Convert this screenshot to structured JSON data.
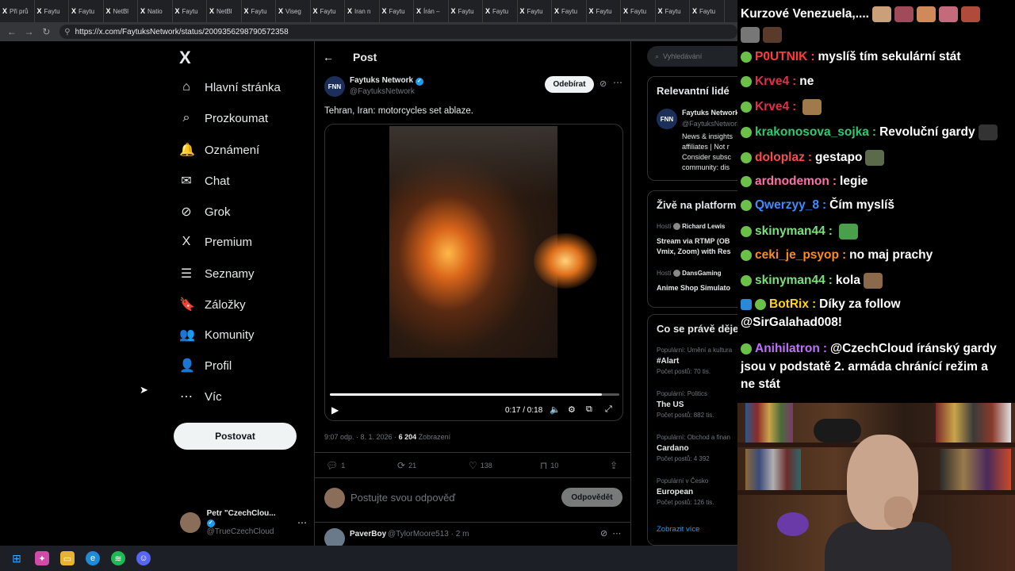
{
  "browser": {
    "tabs": [
      "Při prů",
      "Faytu",
      "Faytu",
      "NetBl",
      "Natio",
      "Faytu",
      "NetBl",
      "Faytu",
      "Viseg",
      "Faytu",
      "Iran n",
      "Faytu",
      "Írán –",
      "Faytu",
      "Faytu",
      "Faytu",
      "Faytu",
      "Faytu",
      "Faytu",
      "Faytu",
      "Faytu"
    ],
    "url": "https://x.com/FaytuksNetwork/status/2009356298790572358"
  },
  "sidebar": {
    "logo": "X",
    "items": [
      {
        "label": "Hlavní stránka",
        "icon": "home-icon",
        "glyph": "⌂"
      },
      {
        "label": "Prozkoumat",
        "icon": "search-icon",
        "glyph": "⌕"
      },
      {
        "label": "Oznámení",
        "icon": "bell-icon",
        "glyph": "🔔"
      },
      {
        "label": "Chat",
        "icon": "mail-icon",
        "glyph": "✉"
      },
      {
        "label": "Grok",
        "icon": "grok-icon",
        "glyph": "⊘"
      },
      {
        "label": "Premium",
        "icon": "x-icon",
        "glyph": "X"
      },
      {
        "label": "Seznamy",
        "icon": "list-icon",
        "glyph": "☰"
      },
      {
        "label": "Záložky",
        "icon": "bookmark-icon",
        "glyph": "🔖"
      },
      {
        "label": "Komunity",
        "icon": "community-icon",
        "glyph": "👥"
      },
      {
        "label": "Profil",
        "icon": "profile-icon",
        "glyph": "👤"
      },
      {
        "label": "Víc",
        "icon": "more-icon",
        "glyph": "⋯"
      }
    ],
    "post_button": "Postovat",
    "account": {
      "name": "Petr \"CzechClou...",
      "handle": "@TrueCzechCloud"
    }
  },
  "post": {
    "header": "Post",
    "author_name": "Faytuks Network",
    "author_handle": "@FaytuksNetwork",
    "avatar_text": "FNN",
    "follow_label": "Odebírat",
    "text": "Tehran, Iran: motorcycles set ablaze.",
    "video": {
      "time": "0:17 / 0:18",
      "progress": 0.94
    },
    "meta_time": "9:07 odp. · 8. 1. 2026 · ",
    "views": "6 204",
    "views_label": " Zobrazení",
    "actions": {
      "replies": "1",
      "reposts": "21",
      "likes": "138",
      "bookmarks": "10"
    },
    "reply_placeholder": "Postujte svou odpověď",
    "reply_button": "Odpovědět",
    "next_reply": {
      "name": "PaverBoy",
      "handle": "@TylorMoore513 · 2 m"
    }
  },
  "right": {
    "search_placeholder": "Vyhledávání",
    "relevant": {
      "title": "Relevantní lidé",
      "name": "Faytuks Network",
      "handle": "@FaytuksNetwork",
      "bio": [
        "News & insights",
        "affiliates | Not r",
        "Consider subsc",
        "community: dis"
      ]
    },
    "live": {
      "title": "Živě na platform",
      "host1_prefix": "Hostí",
      "host1": "Richard Lewis",
      "stream1": [
        "Stream via RTMP (OB",
        "Vmix, Zoom) with Res"
      ],
      "host2_prefix": "Hostí",
      "host2": "DansGaming",
      "stream2": "Anime Shop Simulato"
    },
    "trends": {
      "title": "Co se právě děje",
      "items": [
        {
          "category": "Populární: Umění a kultura",
          "name": "#Alart",
          "count": "Počet postů: 70 tis."
        },
        {
          "category": "Populární: Politics",
          "name": "The US",
          "count": "Počet postů: 882 tis."
        },
        {
          "category": "Populární: Obchod a finan",
          "name": "Cardano",
          "count": "Počet postů: 4 392"
        },
        {
          "category": "Populární v Česko",
          "name": "European",
          "count": "Počet postů: 126 tis."
        }
      ],
      "show_more": "Zobrazit více"
    }
  },
  "chat": {
    "top_partial": "Kurzové Venezuela,....",
    "messages": [
      {
        "user": "P0UTNIK",
        "color": "#ff3b3b",
        "text": "myslíš tím sekulární stát"
      },
      {
        "user": "Krve4",
        "color": "#e0304a",
        "text": "ne"
      },
      {
        "user": "Krve4",
        "color": "#e0304a",
        "text": ""
      },
      {
        "user": "krakonosova_sojka",
        "color": "#2ecc71",
        "text": "Revoluční gardy"
      },
      {
        "user": "doloplaz",
        "color": "#ff4a4a",
        "text": "gestapo"
      },
      {
        "user": "ardnodemon",
        "color": "#ff6fa8",
        "text": "legie"
      },
      {
        "user": "Qwerzyy_8",
        "color": "#3b8eff",
        "text": "Čím myslíš"
      },
      {
        "user": "skinyman44",
        "color": "#7ae07a",
        "text": ""
      },
      {
        "user": "ceki_je_psyop",
        "color": "#ff8c1a",
        "text": "no maj prachy"
      },
      {
        "user": "skinyman44",
        "color": "#7ae07a",
        "text": "kola"
      },
      {
        "user": "BotRix",
        "color": "#ffd21e",
        "text": "Díky za follow"
      },
      {
        "user": "",
        "color": "#ffffff",
        "text": "@SirGalahad008!"
      },
      {
        "user": "Anihilatron",
        "color": "#c070ff",
        "text": "@CzechCloud íránský gardy"
      },
      {
        "user": "",
        "color": "#ffffff",
        "text": "jsou v podstatě 2. armáda chránící režim a"
      },
      {
        "user": "",
        "color": "#ffffff",
        "text": "ne stát"
      }
    ]
  }
}
